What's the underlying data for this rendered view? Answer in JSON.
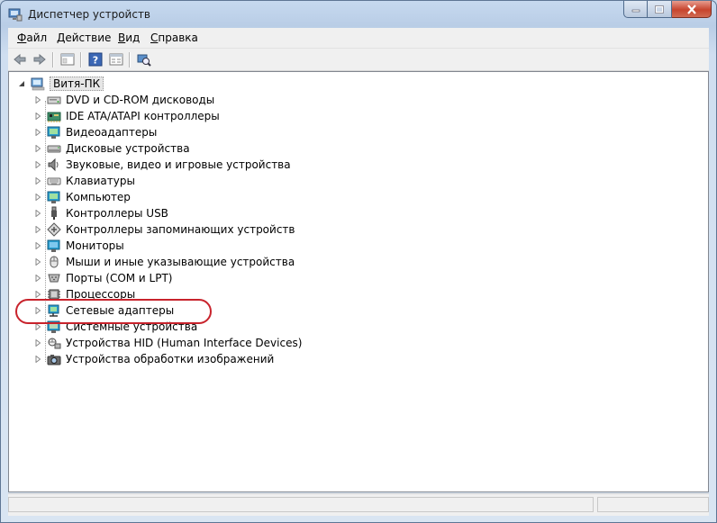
{
  "window": {
    "title": "Диспетчер устройств"
  },
  "menu": {
    "file": {
      "underline": "Ф",
      "rest": "айл"
    },
    "action": {
      "underline": "Д",
      "rest": "ействие"
    },
    "view": {
      "underline": "В",
      "rest": "ид"
    },
    "help": {
      "underline": "С",
      "rest": "правка"
    }
  },
  "toolbar": {
    "icons": [
      "back-icon",
      "forward-icon",
      "show-hide-console-tree-icon",
      "help-icon",
      "properties-icon",
      "scan-hardware-icon"
    ]
  },
  "tree": {
    "root": {
      "label": "Витя-ПК",
      "icon": "computer-icon",
      "expanded": true
    },
    "items": [
      {
        "label": "DVD и CD-ROM дисководы",
        "icon": "dvd-drive-icon"
      },
      {
        "label": "IDE ATA/ATAPI контроллеры",
        "icon": "ide-controller-icon"
      },
      {
        "label": "Видеоадаптеры",
        "icon": "display-adapter-icon"
      },
      {
        "label": "Дисковые устройства",
        "icon": "disk-drive-icon"
      },
      {
        "label": "Звуковые, видео и игровые устройства",
        "icon": "speaker-icon"
      },
      {
        "label": "Клавиатуры",
        "icon": "keyboard-icon"
      },
      {
        "label": "Компьютер",
        "icon": "computer-monitor-icon"
      },
      {
        "label": "Контроллеры USB",
        "icon": "usb-icon"
      },
      {
        "label": "Контроллеры запоминающих устройств",
        "icon": "storage-controller-icon"
      },
      {
        "label": "Мониторы",
        "icon": "monitor-icon"
      },
      {
        "label": "Мыши и иные указывающие устройства",
        "icon": "mouse-icon"
      },
      {
        "label": "Порты (COM и LPT)",
        "icon": "port-icon"
      },
      {
        "label": "Процессоры",
        "icon": "processor-icon"
      },
      {
        "label": "Сетевые адаптеры",
        "icon": "network-adapter-icon"
      },
      {
        "label": "Системные устройства",
        "icon": "system-devices-icon"
      },
      {
        "label": "Устройства HID (Human Interface Devices)",
        "icon": "hid-icon"
      },
      {
        "label": "Устройства обработки изображений",
        "icon": "imaging-device-icon"
      }
    ]
  },
  "annotation": {
    "highlighted_item": "Сетевые адаптеры",
    "color": "#c8232c"
  }
}
